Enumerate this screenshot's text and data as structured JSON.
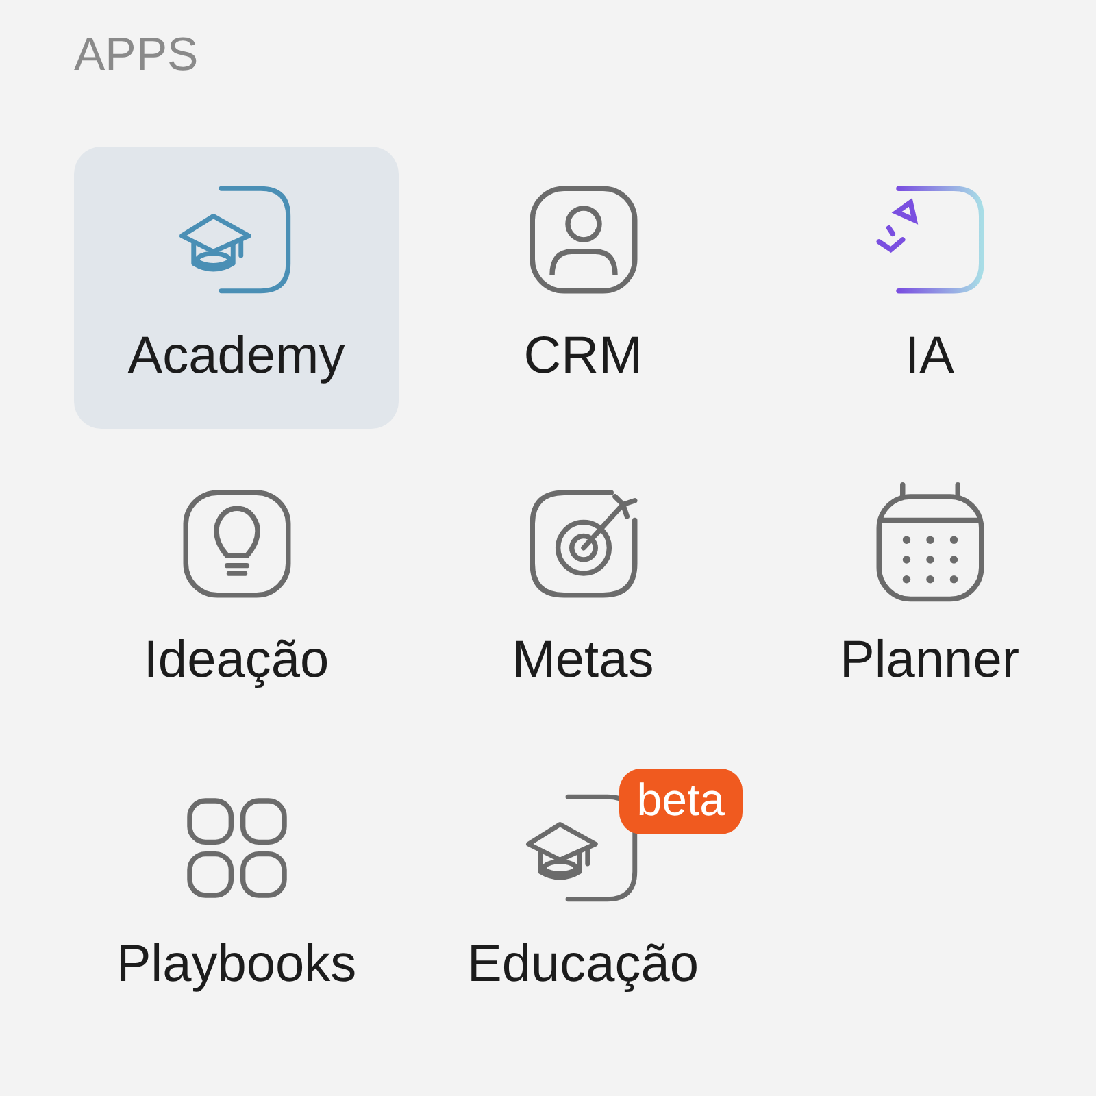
{
  "section_title": "APPS",
  "apps": [
    {
      "label": "Academy",
      "kind": "academy",
      "selected": true
    },
    {
      "label": "CRM",
      "kind": "crm",
      "selected": false
    },
    {
      "label": "IA",
      "kind": "ai",
      "selected": false
    },
    {
      "label": "Ideação",
      "kind": "ideas",
      "selected": false
    },
    {
      "label": "Metas",
      "kind": "goals",
      "selected": false
    },
    {
      "label": "Planner",
      "kind": "planner",
      "selected": false
    },
    {
      "label": "Playbooks",
      "kind": "playbooks",
      "selected": false
    },
    {
      "label": "Educação",
      "kind": "education",
      "selected": false,
      "badge": "beta"
    }
  ]
}
